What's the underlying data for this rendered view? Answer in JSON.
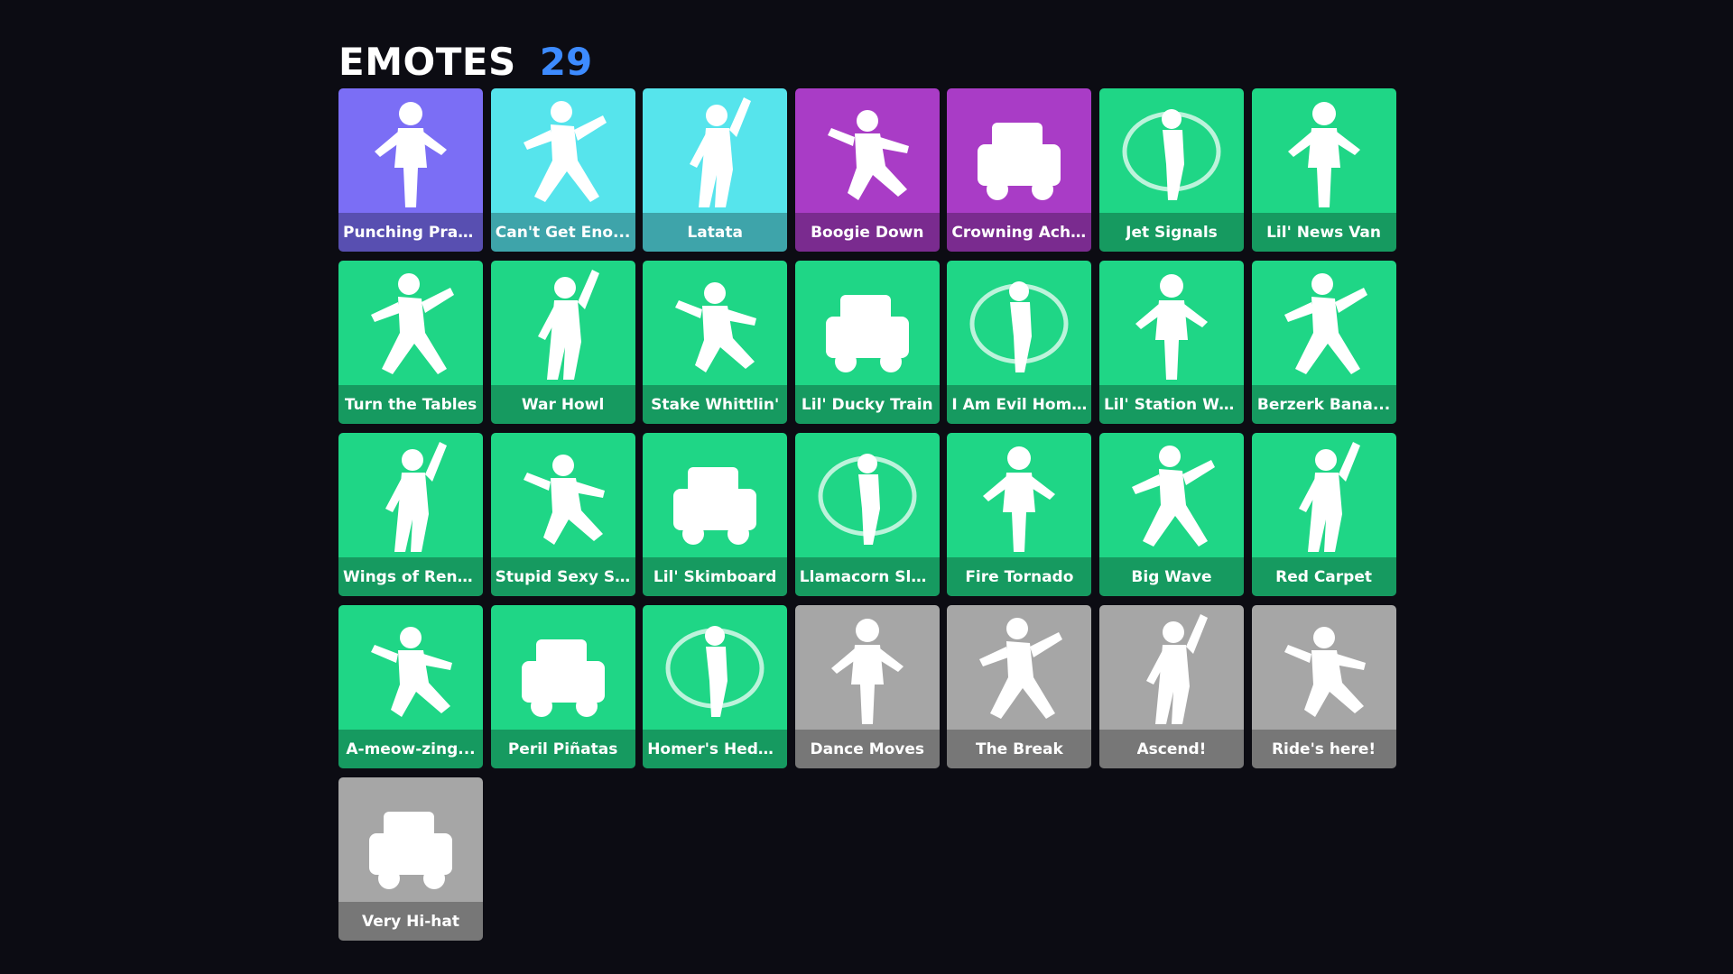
{
  "header": {
    "title": "EMOTES",
    "count": "29"
  },
  "emotes": [
    {
      "label": "Punching Prac...",
      "color": "#7b6ef5",
      "icon": "boxer-figure-icon"
    },
    {
      "label": "Can't Get Eno...",
      "color": "#56e4ec",
      "icon": "dancer-arm-up-icon"
    },
    {
      "label": "Latata",
      "color": "#56e4ec",
      "icon": "dancer-lunge-icon"
    },
    {
      "label": "Boogie Down",
      "color": "#a93cc6",
      "icon": "dancer-figure-icon"
    },
    {
      "label": "Crowning Achi...",
      "color": "#a93cc6",
      "icon": "crown-tray-figure-icon"
    },
    {
      "label": "Jet Signals",
      "color": "#1fd686",
      "icon": "lunge-figure-icon"
    },
    {
      "label": "Lil' News Van",
      "color": "#1fd686",
      "icon": "news-van-icon"
    },
    {
      "label": "Turn the Tables",
      "color": "#1fd686",
      "icon": "dj-figure-icon"
    },
    {
      "label": "War Howl",
      "color": "#1fd686",
      "icon": "warrior-figure-icon"
    },
    {
      "label": "Stake Whittlin'",
      "color": "#1fd686",
      "icon": "seated-figure-icon"
    },
    {
      "label": "Lil' Ducky Train",
      "color": "#1fd686",
      "icon": "ducky-train-icon"
    },
    {
      "label": "I Am Evil Homer",
      "color": "#1fd686",
      "icon": "evil-homer-icon"
    },
    {
      "label": "Lil' Station Wa...",
      "color": "#1fd686",
      "icon": "station-wagon-icon"
    },
    {
      "label": "Berzerk Bana...",
      "color": "#1fd686",
      "icon": "banana-figure-icon"
    },
    {
      "label": "Wings of Reno...",
      "color": "#1fd686",
      "icon": "winged-figure-icon"
    },
    {
      "label": "Stupid Sexy Sk...",
      "color": "#1fd686",
      "icon": "skier-figure-icon"
    },
    {
      "label": "Lil' Skimboard",
      "color": "#1fd686",
      "icon": "skimboard-figure-icon"
    },
    {
      "label": "Llamacorn Sle...",
      "color": "#1fd686",
      "icon": "llamacorn-sled-icon"
    },
    {
      "label": "Fire Tornado",
      "color": "#1fd686",
      "icon": "fire-tornado-icon"
    },
    {
      "label": "Big Wave",
      "color": "#1fd686",
      "icon": "waving-figure-icon"
    },
    {
      "label": "Red Carpet",
      "color": "#1fd686",
      "icon": "posing-figure-icon"
    },
    {
      "label": "A-meow-zing...",
      "color": "#1fd686",
      "icon": "magician-figure-icon"
    },
    {
      "label": "Peril Piñatas",
      "color": "#1fd686",
      "icon": "pinata-figure-icon"
    },
    {
      "label": "Homer's Hedg...",
      "color": "#1fd686",
      "icon": "hedge-figure-icon"
    },
    {
      "label": "Dance Moves",
      "color": "#a6a6a6",
      "icon": "running-figure-icon"
    },
    {
      "label": "The Break",
      "color": "#a6a6a6",
      "icon": "drum-kit-icon"
    },
    {
      "label": "Ascend!",
      "color": "#a6a6a6",
      "icon": "ascending-figure-icon"
    },
    {
      "label": "Ride's here!",
      "color": "#a6a6a6",
      "icon": "spotlight-figure-icon"
    },
    {
      "label": "Very Hi-hat",
      "color": "#a6a6a6",
      "icon": "drummer-figure-icon"
    }
  ]
}
